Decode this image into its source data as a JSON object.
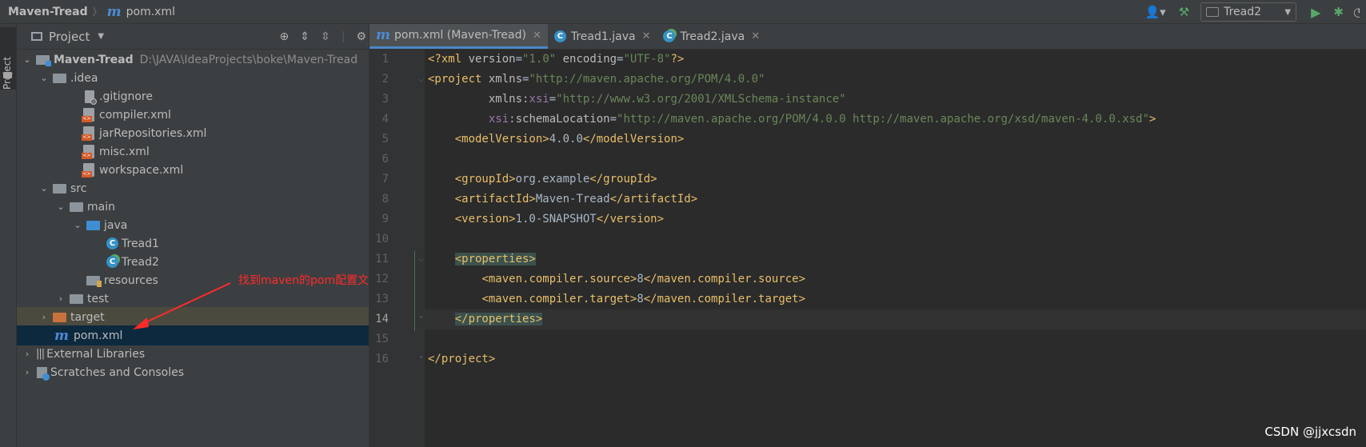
{
  "breadcrumb": {
    "project": "Maven-Tread",
    "file": "pom.xml"
  },
  "toolbar": {
    "run_config": "Tread2"
  },
  "side_strip": {
    "label": "Project"
  },
  "project_panel": {
    "title": "Project",
    "tree": [
      {
        "label": "Maven-Tread",
        "path": "D:\\JAVA\\IdeaProjects\\boke\\Maven-Tread"
      },
      {
        "label": ".idea"
      },
      {
        "label": ".gitignore"
      },
      {
        "label": "compiler.xml"
      },
      {
        "label": "jarRepositories.xml"
      },
      {
        "label": "misc.xml"
      },
      {
        "label": "workspace.xml"
      },
      {
        "label": "src"
      },
      {
        "label": "main"
      },
      {
        "label": "java"
      },
      {
        "label": "Tread1"
      },
      {
        "label": "Tread2"
      },
      {
        "label": "resources"
      },
      {
        "label": "test"
      },
      {
        "label": "target"
      },
      {
        "label": "pom.xml"
      },
      {
        "label": "External Libraries"
      },
      {
        "label": "Scratches and Consoles"
      }
    ]
  },
  "annotation": {
    "text": "找到maven的pom配置文件",
    "color": "#ff2a2a"
  },
  "editor": {
    "tabs": [
      {
        "label": "pom.xml (Maven-Tread)"
      },
      {
        "label": "Tread1.java"
      },
      {
        "label": "Tread2.java"
      }
    ],
    "line_numbers": [
      "1",
      "2",
      "3",
      "4",
      "5",
      "6",
      "7",
      "8",
      "9",
      "10",
      "11",
      "12",
      "13",
      "14",
      "15",
      "16"
    ],
    "current_line": 14,
    "code": {
      "l1": {
        "t1": "<?xml ",
        "a1": "version",
        "e1": "=",
        "v1": "\"1.0\"",
        "a2": " encoding",
        "e2": "=",
        "v2": "\"UTF-8\"",
        "t2": "?>"
      },
      "l2": {
        "t1": "<project ",
        "a1": "xmlns",
        "e1": "=",
        "v1": "\"http://maven.apache.org/POM/4.0.0\""
      },
      "l3": {
        "a1": "xmlns",
        "c1": ":",
        "ns1": "xsi",
        "e1": "=",
        "v1": "\"http://www.w3.org/2001/XMLSchema-instance\""
      },
      "l4": {
        "ns1": "xsi",
        "c1": ":",
        "a1": "schemaLocation",
        "e1": "=",
        "v1": "\"http://maven.apache.org/POM/4.0.0 http://maven.apache.org/xsd/maven-4.0.0.xsd\"",
        "t1": ">"
      },
      "l5": {
        "o": "<modelVersion>",
        "txt": "4.0.0",
        "c": "</modelVersion>"
      },
      "l7": {
        "o": "<groupId>",
        "txt": "org.example",
        "c": "</groupId>"
      },
      "l8": {
        "o": "<artifactId>",
        "txt": "Maven-Tread",
        "c": "</artifactId>"
      },
      "l9": {
        "o": "<version>",
        "txt": "1.0-SNAPSHOT",
        "c": "</version>"
      },
      "l11": {
        "o": "<properties>"
      },
      "l12": {
        "o": "<maven.compiler.source>",
        "txt": "8",
        "c": "</maven.compiler.source>"
      },
      "l13": {
        "o": "<maven.compiler.target>",
        "txt": "8",
        "c": "</maven.compiler.target>"
      },
      "l14": {
        "c": "</properties>"
      },
      "l16": {
        "c": "</project>"
      }
    }
  },
  "watermark": "CSDN @jjxcsdn"
}
